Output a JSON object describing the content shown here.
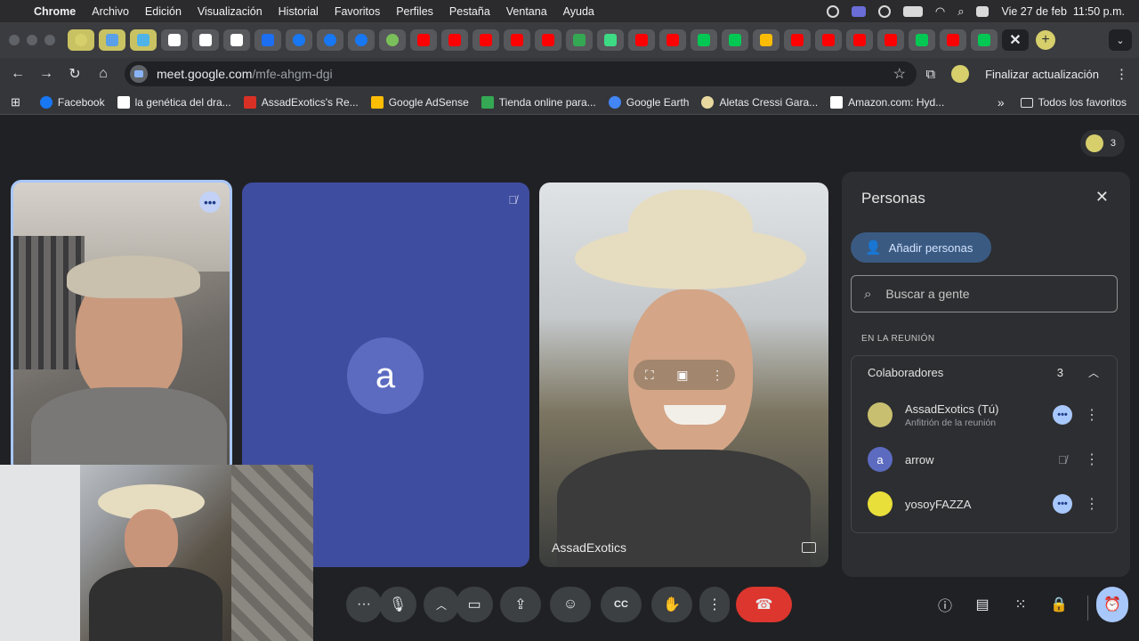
{
  "menubar": {
    "app": "Chrome",
    "items": [
      "Archivo",
      "Edición",
      "Visualización",
      "Historial",
      "Favoritos",
      "Perfiles",
      "Pestaña",
      "Ventana",
      "Ayuda"
    ],
    "datetime": "Vie 27 de feb  11:50 p.m."
  },
  "tabs": {
    "icons": [
      "chrome",
      "weather",
      "cloud",
      "c",
      "c",
      "c",
      "meta",
      "facebook",
      "facebook",
      "facebook",
      "earth",
      "youtube",
      "youtube",
      "youtube",
      "youtube",
      "youtube",
      "app",
      "android",
      "youtube",
      "youtube",
      "k",
      "k",
      "drive",
      "youtube",
      "youtube",
      "youtube",
      "youtube",
      "k",
      "youtube",
      "k"
    ],
    "active_close": "✕",
    "new_tab": "+"
  },
  "navbar": {
    "url_host": "meet.google.com",
    "url_path": "/mfe-ahgm-dgi",
    "update_label": "Finalizar actualización"
  },
  "bookmarks": {
    "items": [
      {
        "label": "Facebook",
        "color": "#1877f2"
      },
      {
        "label": "la genética del dra...",
        "color": "#ffffff"
      },
      {
        "label": "AssadExotics's Re...",
        "color": "#d93025"
      },
      {
        "label": "Google AdSense",
        "color": "#fbbc04"
      },
      {
        "label": "Tienda online para...",
        "color": "#34a853"
      },
      {
        "label": "Google Earth",
        "color": "#4285f4"
      },
      {
        "label": "Aletas Cressi Gara...",
        "color": "#e8d9a0"
      },
      {
        "label": "Amazon.com: Hyd...",
        "color": "#ffffff"
      }
    ],
    "all_favorites": "Todos los favoritos"
  },
  "meet": {
    "participant_count": "3",
    "tile2_avatar": "a",
    "tile3_name": "AssadExotics"
  },
  "panel": {
    "title": "Personas",
    "add_people": "Añadir personas",
    "search_placeholder": "Buscar a gente",
    "section": "EN LA REUNIÓN",
    "group": "Colaboradores",
    "group_count": "3",
    "people": [
      {
        "name": "AssadExotics (Tú)",
        "subtitle": "Anfitrión de la reunión",
        "avatar": "",
        "state": "dots"
      },
      {
        "name": "arrow",
        "subtitle": "",
        "avatar": "a",
        "state": "muted"
      },
      {
        "name": "yosoyFAZZA",
        "subtitle": "",
        "avatar": "",
        "state": "dots"
      }
    ]
  },
  "colors": {
    "accent": "#a8c7fa",
    "end_call": "#dc362e",
    "tile_avatar_bg": "#3f4da0"
  }
}
